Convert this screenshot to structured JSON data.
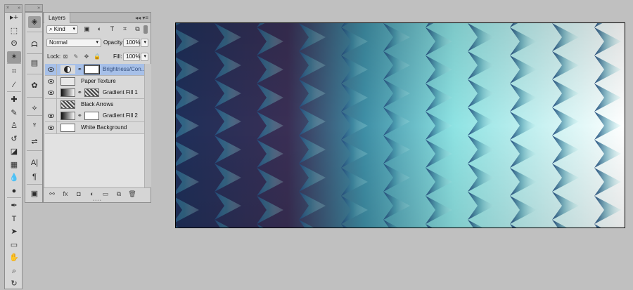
{
  "tools_header": {
    "close_glyph": "×",
    "collapse_glyph": "»"
  },
  "tools": [
    {
      "name": "move-tool-icon",
      "glyph": "▸+"
    },
    {
      "name": "marquee-tool-icon",
      "glyph": "⬚"
    },
    {
      "name": "lasso-tool-icon",
      "glyph": "ʘ"
    },
    {
      "name": "magic-wand-tool-icon",
      "glyph": "✶",
      "selected": true
    },
    {
      "name": "crop-tool-icon",
      "glyph": "⌗"
    },
    {
      "name": "eyedropper-tool-icon",
      "glyph": "⁄"
    },
    {
      "name": "healing-brush-tool-icon",
      "glyph": "✚"
    },
    {
      "name": "brush-tool-icon",
      "glyph": "✎"
    },
    {
      "name": "clone-stamp-tool-icon",
      "glyph": "♙"
    },
    {
      "name": "history-brush-tool-icon",
      "glyph": "↺"
    },
    {
      "name": "eraser-tool-icon",
      "glyph": "◪"
    },
    {
      "name": "gradient-tool-icon",
      "glyph": "▦"
    },
    {
      "name": "blur-tool-icon",
      "glyph": "💧"
    },
    {
      "name": "dodge-tool-icon",
      "glyph": "●"
    },
    {
      "name": "pen-tool-icon",
      "glyph": "✒"
    },
    {
      "name": "type-tool-icon",
      "glyph": "T"
    },
    {
      "name": "path-selection-tool-icon",
      "glyph": "➤"
    },
    {
      "name": "shape-tool-icon",
      "glyph": "▭"
    },
    {
      "name": "hand-tool-icon",
      "glyph": "✋"
    },
    {
      "name": "zoom-tool-icon",
      "glyph": "⌕"
    },
    {
      "name": "rotate-view-tool-icon",
      "glyph": "↻"
    }
  ],
  "dock": {
    "collapse_glyph": "»",
    "items": [
      {
        "name": "layers-panel-icon",
        "glyph": "◈",
        "selected": true
      },
      {
        "name": "navigator-panel-icon",
        "glyph": "ᗩ"
      },
      {
        "name": "histogram-panel-icon",
        "glyph": "▤"
      },
      {
        "name": "swatches-panel-icon",
        "glyph": "✿"
      },
      {
        "name": "paths-panel-icon",
        "glyph": "⟡"
      },
      {
        "name": "brush-presets-panel-icon",
        "glyph": "♆"
      },
      {
        "name": "adjustments-panel-icon",
        "glyph": "⇌"
      },
      {
        "name": "character-panel-icon",
        "glyph": "A|"
      },
      {
        "name": "paragraph-panel-icon",
        "glyph": "¶"
      },
      {
        "name": "actions-panel-icon",
        "glyph": "▣"
      }
    ]
  },
  "layers_panel": {
    "tab": "Layers",
    "tab_controls": "◂◂  ▾≡",
    "filter": {
      "kind": "Kind",
      "search_glyph": "⌕",
      "icons": [
        {
          "name": "filter-pixel-icon",
          "glyph": "▣"
        },
        {
          "name": "filter-adjustment-icon",
          "glyph": "◐"
        },
        {
          "name": "filter-type-icon",
          "glyph": "T"
        },
        {
          "name": "filter-shape-icon",
          "glyph": "⌗"
        },
        {
          "name": "filter-smart-object-icon",
          "glyph": "⧉"
        }
      ]
    },
    "blend_mode": "Normal",
    "opacity_label": "Opacity:",
    "opacity_value": "100%",
    "lock_label": "Lock:",
    "lock_icons": [
      {
        "name": "lock-transparent-icon",
        "glyph": "⊠"
      },
      {
        "name": "lock-image-icon",
        "glyph": "✎"
      },
      {
        "name": "lock-position-icon",
        "glyph": "✥"
      },
      {
        "name": "lock-all-icon",
        "glyph": "🔒"
      }
    ],
    "fill_label": "Fill:",
    "fill_value": "100%",
    "layers": [
      {
        "name": "Brightness/Con...",
        "visible": true,
        "selected": true,
        "thumb": "adjustment",
        "mask": true
      },
      {
        "name": "Paper Texture",
        "visible": true,
        "selected": false,
        "thumb": "paper",
        "mask": false
      },
      {
        "name": "Gradient Fill 1",
        "visible": true,
        "selected": false,
        "thumb": "gradient",
        "mask": true,
        "mask_kind": "pattern"
      },
      {
        "name": "Black Arrows",
        "visible": false,
        "selected": false,
        "thumb": "pattern",
        "mask": false
      },
      {
        "name": "Gradient Fill 2",
        "visible": true,
        "selected": false,
        "thumb": "gradient",
        "mask": true
      },
      {
        "name": "White Background",
        "visible": true,
        "selected": false,
        "thumb": "white",
        "mask": false
      }
    ],
    "footer_icons": [
      {
        "name": "link-layers-icon",
        "glyph": "⚯"
      },
      {
        "name": "layer-style-icon",
        "glyph": "fx"
      },
      {
        "name": "add-mask-icon",
        "glyph": "◘"
      },
      {
        "name": "new-adjustment-layer-icon",
        "glyph": "◐"
      },
      {
        "name": "new-group-icon",
        "glyph": "▭"
      },
      {
        "name": "new-layer-icon",
        "glyph": "⧉"
      },
      {
        "name": "delete-layer-icon",
        "glyph": "🗑"
      }
    ]
  },
  "canvas_colors": {
    "left": "#1e2f59",
    "mid_dark": "#3a2f55",
    "mid": "#3f8fa6",
    "light": "#8ee3e3",
    "right": "#ffffff",
    "arrow_dark": "#24497d",
    "arrow_light": "#bff3f0"
  }
}
